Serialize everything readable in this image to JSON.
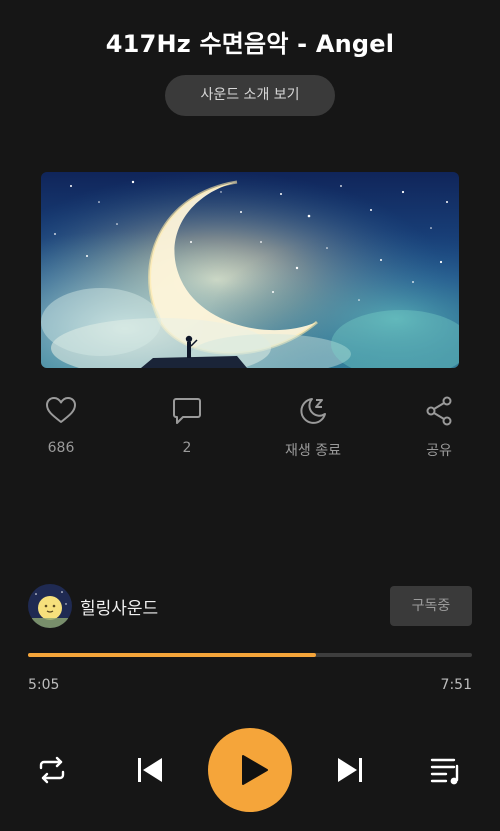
{
  "header": {
    "title": "417Hz 수면음악 - Angel",
    "intro_button": "사운드 소개 보기"
  },
  "artwork": {
    "description_icon": "moon-night-artwork"
  },
  "actions": {
    "like": {
      "icon": "heart-icon",
      "label": "686"
    },
    "comment": {
      "icon": "comment-icon",
      "label": "2"
    },
    "sleep_timer": {
      "icon": "moon-zz-icon",
      "label": "재생 종료"
    },
    "share": {
      "icon": "share-icon",
      "label": "공유"
    }
  },
  "channel": {
    "name": "힐링사운드",
    "subscribe_label": "구독중"
  },
  "playback": {
    "current_time": "5:05",
    "total_time": "7:51",
    "progress": 0.648
  },
  "controls": {
    "repeat_icon": "repeat-icon",
    "prev_icon": "skip-previous-icon",
    "play_icon": "play-icon",
    "next_icon": "skip-next-icon",
    "playlist_icon": "playlist-icon"
  },
  "colors": {
    "accent": "#f5a53a",
    "background": "#161616",
    "muted_text": "#9a9a9a"
  }
}
